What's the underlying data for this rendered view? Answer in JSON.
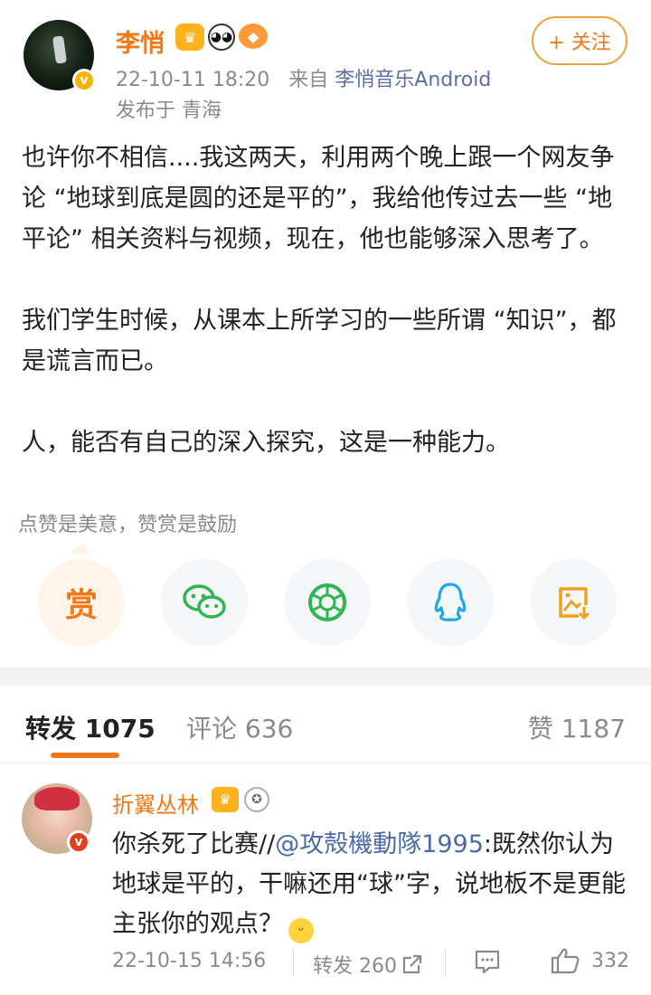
{
  "post": {
    "username": "李悄",
    "badges": [
      "crown-badge",
      "panda-badge",
      "bird-badge"
    ],
    "timestamp": "22-10-11 18:20",
    "source_prefix": "来自",
    "source": "李悄音乐Android",
    "location": "发布于 青海",
    "follow_label": "+ 关注",
    "paragraphs": [
      "也许你不相信....我这两天，利用两个晚上跟一个网友争论 “地球到底是圆的还是平的”，我给他传过去一些 “地平论” 相关资料与视频，现在，他也能够深入思考了。",
      "我们学生时候，从课本上所学习的一些所谓 “知识”，都是谎言而已。",
      "人，能否有自己的深入探究，这是一种能力。"
    ]
  },
  "reward": {
    "hint": "点赞是美意，赞赏是鼓励",
    "button_label": "赏"
  },
  "share": {
    "icons": [
      "wechat-icon",
      "moments-icon",
      "qq-icon",
      "save-image-icon"
    ]
  },
  "tabs": {
    "repost": "转发 1075",
    "comments": "评论 636",
    "likes": "赞 1187"
  },
  "comment": {
    "username": "折翼丛林",
    "text_before": "你杀死了比赛//",
    "mention": "@攻殻機動隊1995",
    "text_after": ":既然你认为地球是平的，干嘛还用“球”字，说地板不是更能主张你的观点？",
    "timestamp": "22-10-15 14:56",
    "repost_label": "转发 260",
    "like_count": "332"
  },
  "colors": {
    "accent": "#f07818",
    "link": "#4b6aa8",
    "muted": "#8a8a8a"
  }
}
